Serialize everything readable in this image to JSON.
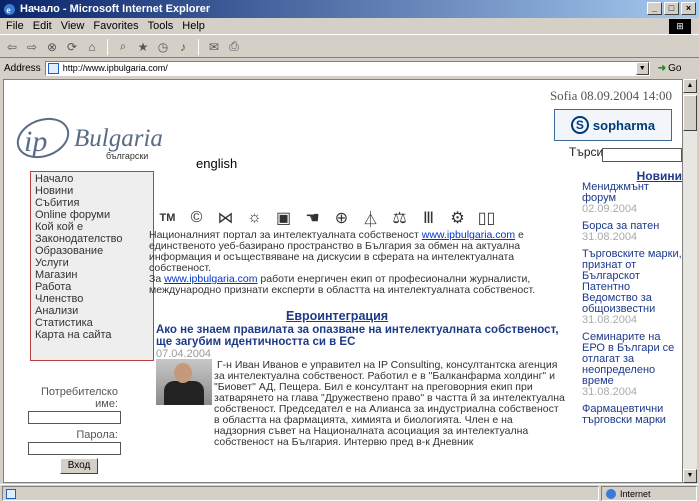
{
  "window": {
    "title": "Начало - Microsoft Internet Explorer"
  },
  "menu": [
    "File",
    "Edit",
    "View",
    "Favorites",
    "Tools",
    "Help"
  ],
  "address": {
    "label": "Address",
    "url": "http://www.ipbulgaria.com/",
    "go_label": "Go"
  },
  "header": {
    "logo_ip": "ip",
    "logo_text": "Bulgaria",
    "date": "Sofia 08.09.2004 14:00",
    "sponsor": "sopharma",
    "lang_bg": "български",
    "lang_en": "english",
    "search_label": "Търси:"
  },
  "nav": [
    "Начало",
    "Новини",
    "Събития",
    "Online форуми",
    "Кой кой е",
    "Законодателство",
    "Образование",
    "Услуги",
    "Магазин",
    "Работа",
    "Членство",
    "Анализи",
    "Статистика",
    "Карта на сайта"
  ],
  "login": {
    "user_label": "Потребителско име:",
    "pass_label": "Парола:",
    "button": "Вход"
  },
  "topic_icons": [
    "TM",
    "©",
    "dna",
    "bulb",
    "box",
    "hand",
    "globe",
    "tower",
    "scales",
    "column",
    "gears",
    "book"
  ],
  "intro": {
    "p1_before": "Националният портал за интелектуалната собственост ",
    "p1_link": "www.ipbulgaria.com",
    "p1_after": " е единственото уеб-базирано пространство в България за обмен на актуална информация и осъществяване на дискусии в сферата на интелектуалната собственост.",
    "p2_before": "За ",
    "p2_link": "www.ipbulgaria.com",
    "p2_after": " работи енергичен екип от професионални журналисти, международно признати експерти в областта на интелектуалната собственост."
  },
  "main": {
    "section": "Евроинтеграция",
    "article_title": "Ако не знаем правилата за опазване на интелектуалната собственост, ще загубим идентичността си в ЕС",
    "article_date": "07.04.2004",
    "article_body": "Г-н Иван Иванов е управител на IP Consulting, консултантска агенция за интелектуална собственост. Работил е в \"Балканфарма холдинг\" и \"Биовет\" АД, Пещера. Бил е консултант на преговорния екип при затварянето на глава \"Дружествено право\" в частта й за интелектуална собственост. Председател е на Алианса за индустриална собственост в областта на фармацията, химията и биологията. Член е на надзорния съвет на Националната асоциация за интелектуална собственост на България. Интервю пред в-к Дневник"
  },
  "news": {
    "heading": "Новини",
    "items": [
      {
        "title": "Мениджмънт форум",
        "date": "02.09.2004"
      },
      {
        "title": "Борса за патен",
        "date": "31.08.2004"
      },
      {
        "title": "Търговските марки, признат от Българскот Патентно Ведомство за общоизвестни",
        "date": "31.08.2004"
      },
      {
        "title": "Семинарите на ЕРО в Българи се отлагат за неопределено време",
        "date": "31.08.2004"
      },
      {
        "title": "Фармацевтични търговски марки",
        "date": ""
      }
    ]
  },
  "status": {
    "zone": "Internet"
  }
}
